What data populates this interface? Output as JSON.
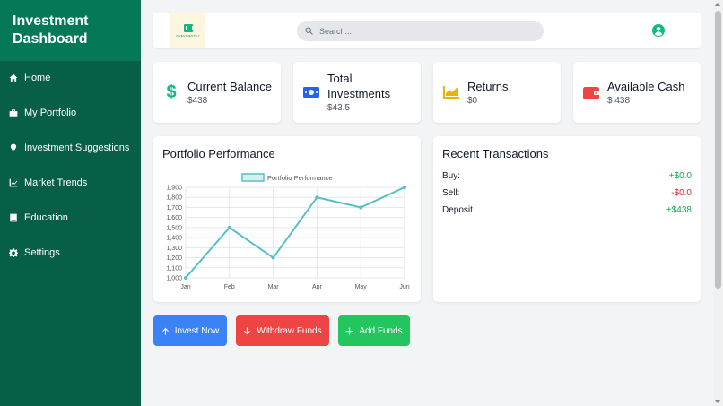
{
  "sidebar": {
    "title_line1": "Investment",
    "title_line2": "Dashboard",
    "items": [
      {
        "label": "Home",
        "icon": "home-icon"
      },
      {
        "label": "My Portfolio",
        "icon": "briefcase-icon"
      },
      {
        "label": "Investment Suggestions",
        "icon": "lightbulb-icon"
      },
      {
        "label": "Market Trends",
        "icon": "chart-line-icon"
      },
      {
        "label": "Education",
        "icon": "book-icon"
      },
      {
        "label": "Settings",
        "icon": "gear-icon"
      }
    ]
  },
  "topbar": {
    "logo_text": "INVESTMENTIFY",
    "search_placeholder": "Search...",
    "user_icon": "user-circle-icon"
  },
  "stats": [
    {
      "title": "Current Balance",
      "value": "$438",
      "icon": "dollar-icon",
      "color": "#10b981"
    },
    {
      "title_line1": "Total",
      "title_line2": "Investments",
      "value": "$43.5",
      "icon": "money-bill-icon",
      "color": "#2563eb"
    },
    {
      "title": "Returns",
      "value": "$0",
      "icon": "chart-area-icon",
      "color": "#eab308"
    },
    {
      "title": "Available Cash",
      "value": "$ 438",
      "icon": "wallet-icon",
      "color": "#ef4444"
    }
  ],
  "performance": {
    "title": "Portfolio Performance"
  },
  "chart_data": {
    "type": "line",
    "categories": [
      "Jan",
      "Feb",
      "Mar",
      "Apr",
      "May",
      "Jun"
    ],
    "series": [
      {
        "name": "Portfolio Performance",
        "values": [
          1000,
          1500,
          1200,
          1800,
          1700,
          1900
        ],
        "color": "#56bfc7"
      }
    ],
    "yticks": [
      1000,
      1100,
      1200,
      1300,
      1400,
      1500,
      1600,
      1700,
      1800,
      1900
    ],
    "ylim": [
      1000,
      1900
    ],
    "legend": "top",
    "grid": true
  },
  "transactions": {
    "title": "Recent Transactions",
    "rows": [
      {
        "label": "Buy:",
        "amount": "+$0.0",
        "type": "pos"
      },
      {
        "label": "Sell:",
        "amount": "-$0.0",
        "type": "neg"
      },
      {
        "label": "Deposit",
        "amount": "+$438",
        "type": "pos"
      }
    ]
  },
  "buttons": {
    "invest": {
      "label": "Invest Now",
      "color": "#3b82f6"
    },
    "withdraw": {
      "label": "Withdraw Funds",
      "color": "#ef4444"
    },
    "add": {
      "label": "Add Funds",
      "color": "#22c55e"
    }
  },
  "colors": {
    "sidebar": "#065f46",
    "sidebar_header": "#047857",
    "accent": "#10b981"
  }
}
